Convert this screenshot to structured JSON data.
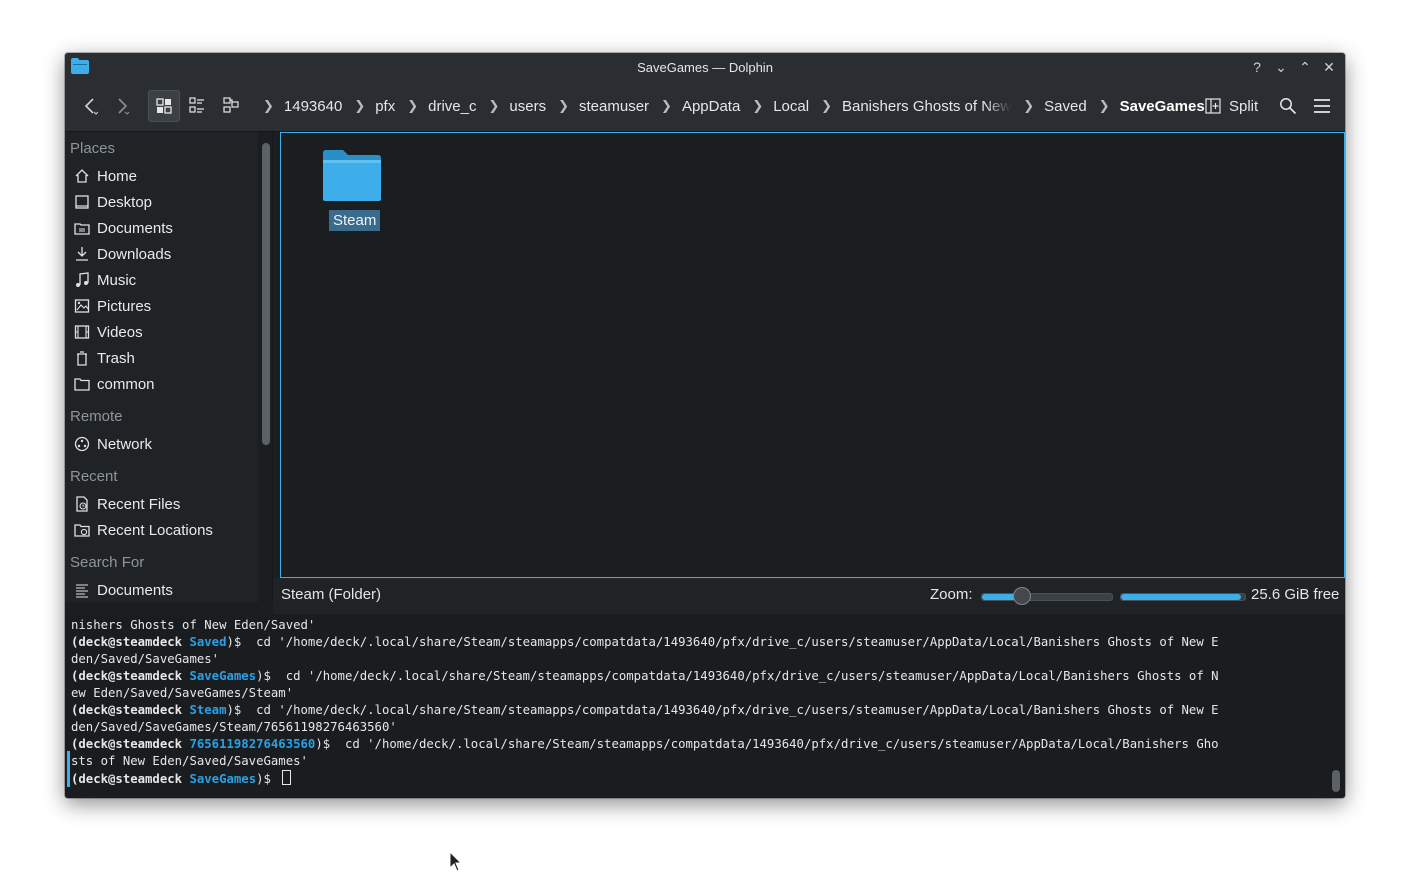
{
  "window": {
    "title": "SaveGames — Dolphin"
  },
  "titlebar_buttons": [
    {
      "name": "help-icon",
      "glyph": "?"
    },
    {
      "name": "minimize-icon",
      "glyph": "⌄"
    },
    {
      "name": "maximize-icon",
      "glyph": "⌃"
    },
    {
      "name": "close-icon",
      "glyph": "✕"
    }
  ],
  "breadcrumbs": [
    {
      "label": "1493640"
    },
    {
      "label": "pfx"
    },
    {
      "label": "drive_c"
    },
    {
      "label": "users"
    },
    {
      "label": "steamuser"
    },
    {
      "label": "AppData"
    },
    {
      "label": "Local"
    },
    {
      "label": "Banishers Ghosts of New"
    },
    {
      "label": "Saved"
    },
    {
      "label": "SaveGames"
    }
  ],
  "toolbar": {
    "split_label": "Split"
  },
  "sidebar": {
    "places_title": "Places",
    "places": [
      {
        "label": "Home",
        "icon": "home-icon"
      },
      {
        "label": "Desktop",
        "icon": "desktop-icon"
      },
      {
        "label": "Documents",
        "icon": "documents-icon"
      },
      {
        "label": "Downloads",
        "icon": "downloads-icon"
      },
      {
        "label": "Music",
        "icon": "music-icon"
      },
      {
        "label": "Pictures",
        "icon": "pictures-icon"
      },
      {
        "label": "Videos",
        "icon": "videos-icon"
      },
      {
        "label": "Trash",
        "icon": "trash-icon"
      },
      {
        "label": "common",
        "icon": "folder-icon"
      }
    ],
    "remote_title": "Remote",
    "remote": [
      {
        "label": "Network",
        "icon": "network-icon"
      }
    ],
    "recent_title": "Recent",
    "recent": [
      {
        "label": "Recent Files",
        "icon": "recent-files-icon"
      },
      {
        "label": "Recent Locations",
        "icon": "recent-locations-icon"
      }
    ],
    "search_title": "Search For",
    "search": [
      {
        "label": "Documents",
        "icon": "search-documents-icon"
      }
    ]
  },
  "files": [
    {
      "name": "Steam",
      "type": "folder",
      "selected": true
    }
  ],
  "statusbar": {
    "status_text": "Steam (Folder)",
    "zoom_label": "Zoom:",
    "zoom_fraction": 0.28,
    "disk_used_fraction": 0.97,
    "free_space": "25.6 GiB free"
  },
  "terminal": {
    "lines": [
      {
        "plain": "nishers Ghosts of New Eden/Saved'"
      },
      {
        "user": "(deck@steamdeck ",
        "dir": "Saved",
        "rest": ")$  cd '/home/deck/.local/share/Steam/steamapps/compatdata/1493640/pfx/drive_c/users/steamuser/AppData/Local/Banishers Ghosts of New E"
      },
      {
        "plain": "den/Saved/SaveGames'"
      },
      {
        "user": "(deck@steamdeck ",
        "dir": "SaveGames",
        "rest": ")$  cd '/home/deck/.local/share/Steam/steamapps/compatdata/1493640/pfx/drive_c/users/steamuser/AppData/Local/Banishers Ghosts of N"
      },
      {
        "plain": "ew Eden/Saved/SaveGames/Steam'"
      },
      {
        "user": "(deck@steamdeck ",
        "dir": "Steam",
        "rest": ")$  cd '/home/deck/.local/share/Steam/steamapps/compatdata/1493640/pfx/drive_c/users/steamuser/AppData/Local/Banishers Ghosts of New E"
      },
      {
        "plain": "den/Saved/SaveGames/Steam/76561198276463560'"
      },
      {
        "user": "(deck@steamdeck ",
        "dir": "76561198276463560",
        "rest": ")$  cd '/home/deck/.local/share/Steam/steamapps/compatdata/1493640/pfx/drive_c/users/steamuser/AppData/Local/Banishers Gho"
      },
      {
        "plain": "sts of New Eden/Saved/SaveGames'"
      },
      {
        "user": "(deck@steamdeck ",
        "dir": "SaveGames",
        "rest": ")$ ",
        "cursor": true
      }
    ]
  },
  "colors": {
    "accent": "#3daee9",
    "window_bg": "#1b1e20",
    "selection": "#3a6b8c"
  }
}
